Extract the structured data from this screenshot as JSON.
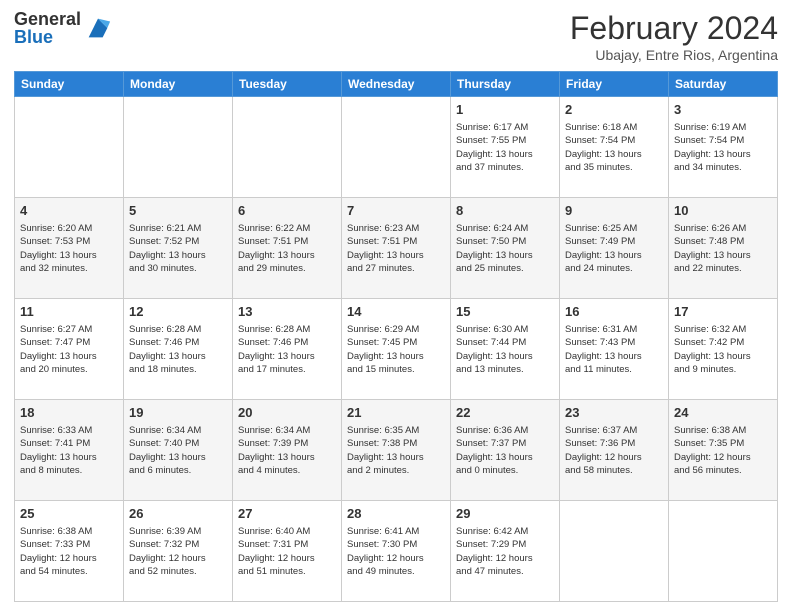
{
  "logo": {
    "general": "General",
    "blue": "Blue"
  },
  "title": "February 2024",
  "subtitle": "Ubajay, Entre Rios, Argentina",
  "days": [
    "Sunday",
    "Monday",
    "Tuesday",
    "Wednesday",
    "Thursday",
    "Friday",
    "Saturday"
  ],
  "weeks": [
    [
      {
        "day": "",
        "info": ""
      },
      {
        "day": "",
        "info": ""
      },
      {
        "day": "",
        "info": ""
      },
      {
        "day": "",
        "info": ""
      },
      {
        "day": "1",
        "info": "Sunrise: 6:17 AM\nSunset: 7:55 PM\nDaylight: 13 hours\nand 37 minutes."
      },
      {
        "day": "2",
        "info": "Sunrise: 6:18 AM\nSunset: 7:54 PM\nDaylight: 13 hours\nand 35 minutes."
      },
      {
        "day": "3",
        "info": "Sunrise: 6:19 AM\nSunset: 7:54 PM\nDaylight: 13 hours\nand 34 minutes."
      }
    ],
    [
      {
        "day": "4",
        "info": "Sunrise: 6:20 AM\nSunset: 7:53 PM\nDaylight: 13 hours\nand 32 minutes."
      },
      {
        "day": "5",
        "info": "Sunrise: 6:21 AM\nSunset: 7:52 PM\nDaylight: 13 hours\nand 30 minutes."
      },
      {
        "day": "6",
        "info": "Sunrise: 6:22 AM\nSunset: 7:51 PM\nDaylight: 13 hours\nand 29 minutes."
      },
      {
        "day": "7",
        "info": "Sunrise: 6:23 AM\nSunset: 7:51 PM\nDaylight: 13 hours\nand 27 minutes."
      },
      {
        "day": "8",
        "info": "Sunrise: 6:24 AM\nSunset: 7:50 PM\nDaylight: 13 hours\nand 25 minutes."
      },
      {
        "day": "9",
        "info": "Sunrise: 6:25 AM\nSunset: 7:49 PM\nDaylight: 13 hours\nand 24 minutes."
      },
      {
        "day": "10",
        "info": "Sunrise: 6:26 AM\nSunset: 7:48 PM\nDaylight: 13 hours\nand 22 minutes."
      }
    ],
    [
      {
        "day": "11",
        "info": "Sunrise: 6:27 AM\nSunset: 7:47 PM\nDaylight: 13 hours\nand 20 minutes."
      },
      {
        "day": "12",
        "info": "Sunrise: 6:28 AM\nSunset: 7:46 PM\nDaylight: 13 hours\nand 18 minutes."
      },
      {
        "day": "13",
        "info": "Sunrise: 6:28 AM\nSunset: 7:46 PM\nDaylight: 13 hours\nand 17 minutes."
      },
      {
        "day": "14",
        "info": "Sunrise: 6:29 AM\nSunset: 7:45 PM\nDaylight: 13 hours\nand 15 minutes."
      },
      {
        "day": "15",
        "info": "Sunrise: 6:30 AM\nSunset: 7:44 PM\nDaylight: 13 hours\nand 13 minutes."
      },
      {
        "day": "16",
        "info": "Sunrise: 6:31 AM\nSunset: 7:43 PM\nDaylight: 13 hours\nand 11 minutes."
      },
      {
        "day": "17",
        "info": "Sunrise: 6:32 AM\nSunset: 7:42 PM\nDaylight: 13 hours\nand 9 minutes."
      }
    ],
    [
      {
        "day": "18",
        "info": "Sunrise: 6:33 AM\nSunset: 7:41 PM\nDaylight: 13 hours\nand 8 minutes."
      },
      {
        "day": "19",
        "info": "Sunrise: 6:34 AM\nSunset: 7:40 PM\nDaylight: 13 hours\nand 6 minutes."
      },
      {
        "day": "20",
        "info": "Sunrise: 6:34 AM\nSunset: 7:39 PM\nDaylight: 13 hours\nand 4 minutes."
      },
      {
        "day": "21",
        "info": "Sunrise: 6:35 AM\nSunset: 7:38 PM\nDaylight: 13 hours\nand 2 minutes."
      },
      {
        "day": "22",
        "info": "Sunrise: 6:36 AM\nSunset: 7:37 PM\nDaylight: 13 hours\nand 0 minutes."
      },
      {
        "day": "23",
        "info": "Sunrise: 6:37 AM\nSunset: 7:36 PM\nDaylight: 12 hours\nand 58 minutes."
      },
      {
        "day": "24",
        "info": "Sunrise: 6:38 AM\nSunset: 7:35 PM\nDaylight: 12 hours\nand 56 minutes."
      }
    ],
    [
      {
        "day": "25",
        "info": "Sunrise: 6:38 AM\nSunset: 7:33 PM\nDaylight: 12 hours\nand 54 minutes."
      },
      {
        "day": "26",
        "info": "Sunrise: 6:39 AM\nSunset: 7:32 PM\nDaylight: 12 hours\nand 52 minutes."
      },
      {
        "day": "27",
        "info": "Sunrise: 6:40 AM\nSunset: 7:31 PM\nDaylight: 12 hours\nand 51 minutes."
      },
      {
        "day": "28",
        "info": "Sunrise: 6:41 AM\nSunset: 7:30 PM\nDaylight: 12 hours\nand 49 minutes."
      },
      {
        "day": "29",
        "info": "Sunrise: 6:42 AM\nSunset: 7:29 PM\nDaylight: 12 hours\nand 47 minutes."
      },
      {
        "day": "",
        "info": ""
      },
      {
        "day": "",
        "info": ""
      }
    ]
  ]
}
